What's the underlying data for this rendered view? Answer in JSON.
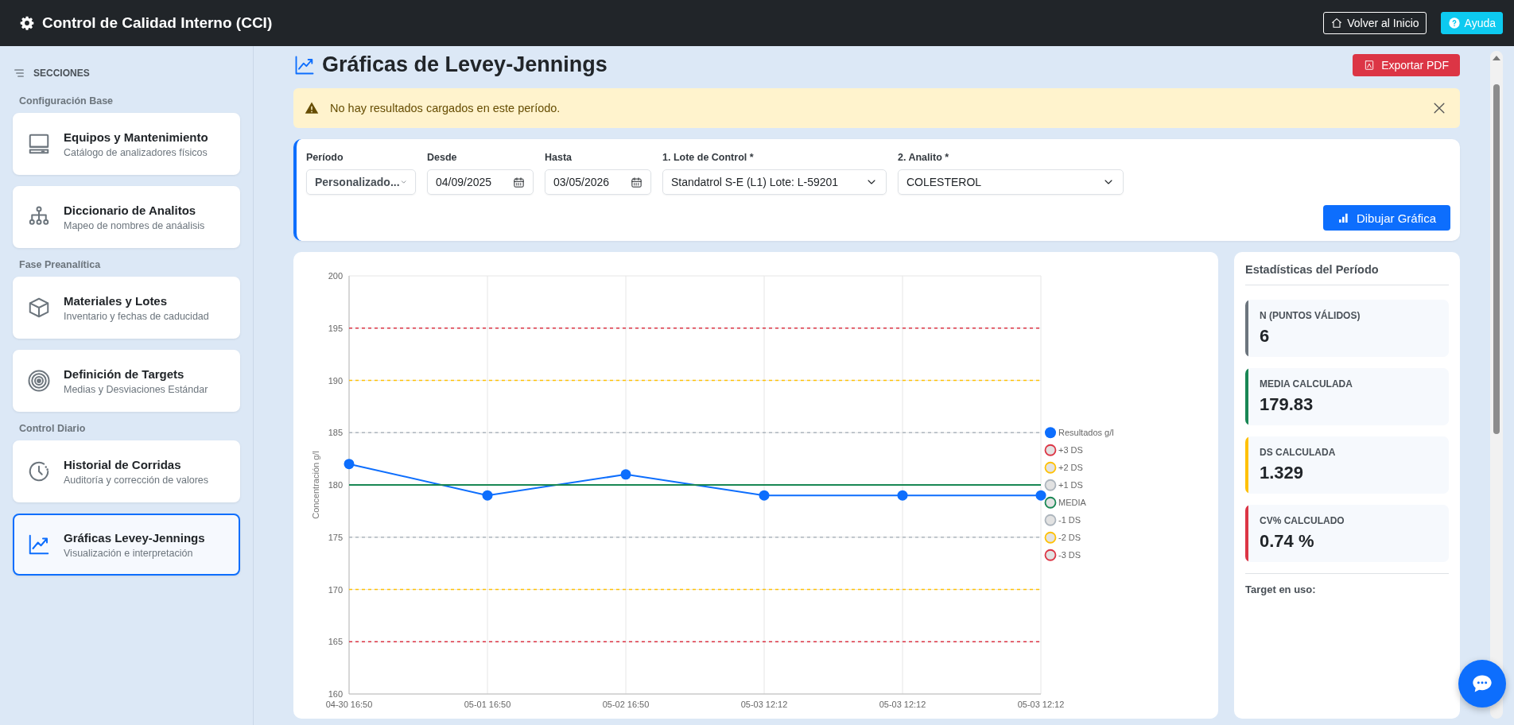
{
  "header": {
    "title": "Control de Calidad Interno (CCI)",
    "buttons": [
      {
        "kind": "home",
        "label": "Volver al Inicio"
      },
      {
        "kind": "help",
        "label": "Ayuda"
      }
    ]
  },
  "sidebar": {
    "heading": "SECCIONES",
    "groups": [
      {
        "title": "Configuración Base",
        "items": [
          {
            "title": "Equipos y Mantenimiento",
            "subtitle": "Catálogo de analizadores físicos",
            "selected": false
          },
          {
            "title": "Diccionario de Analitos",
            "subtitle": "Mapeo de nombres de anáalisis",
            "selected": false
          }
        ]
      },
      {
        "title": "Fase Preanalítica",
        "items": [
          {
            "title": "Materiales y Lotes",
            "subtitle": "Inventario y fechas de caducidad",
            "selected": false
          },
          {
            "title": "Definición de Targets",
            "subtitle": "Medias y Desviaciones Estándar",
            "selected": false
          }
        ]
      },
      {
        "title": "Control Diario",
        "items": [
          {
            "title": "Historial de Corridas",
            "subtitle": "Auditoría y corrección de valores",
            "selected": false
          },
          {
            "title": "Gráficas Levey-Jennings",
            "subtitle": "Visualización e interpretación",
            "selected": true
          }
        ]
      }
    ]
  },
  "page": {
    "title": "Gráficas de Levey-Jennings",
    "export_button": "Exportar PDF"
  },
  "alert": {
    "message": "No hay resultados cargados en este período."
  },
  "filters": {
    "fields": [
      {
        "kind": "select",
        "label": "Período",
        "value": "Personalizado..."
      },
      {
        "kind": "date",
        "label": "Desde",
        "value": "04/09/2025"
      },
      {
        "kind": "date",
        "label": "Hasta",
        "value": "03/05/2026"
      },
      {
        "kind": "select",
        "label": "1. Lote de Control *",
        "value": "Standatrol S-E (L1) Lote: L-59201"
      },
      {
        "kind": "select",
        "label": "2. Analito *",
        "value": "COLESTEROL"
      }
    ],
    "button": "Dibujar Gráfica"
  },
  "chart": {
    "chart_data": {
      "type": "line",
      "grid": true,
      "legend": true,
      "ylabel": "Concentración g/l",
      "categories": [
        "04-30 16:50",
        "05-01 16:50",
        "05-02 16:50",
        "05-03 12:12",
        "05-03 12:12",
        "05-03 12:12"
      ],
      "ylim": [
        160,
        200
      ],
      "yticks": [
        160,
        165,
        170,
        175,
        180,
        185,
        190,
        195,
        200
      ],
      "series": [
        {
          "name": "Resultados g/l",
          "line_style": "solid",
          "marker": "circle",
          "color": "#0d6efd",
          "values": [
            182,
            179,
            181,
            179,
            179,
            179
          ]
        },
        {
          "name": "+3 DS",
          "line_style": "dashed",
          "color": "#dc3545",
          "values": [
            195,
            195,
            195,
            195,
            195,
            195
          ]
        },
        {
          "name": "+2 DS",
          "line_style": "dashed",
          "color": "#ffc107",
          "values": [
            190,
            190,
            190,
            190,
            190,
            190
          ]
        },
        {
          "name": "+1 DS",
          "line_style": "dashed",
          "color": "#adb5bd",
          "values": [
            185,
            185,
            185,
            185,
            185,
            185
          ]
        },
        {
          "name": "MEDIA",
          "line_style": "solid",
          "color": "#198754",
          "values": [
            180,
            180,
            180,
            180,
            180,
            180
          ]
        },
        {
          "name": "-1 DS",
          "line_style": "dashed",
          "color": "#adb5bd",
          "values": [
            175,
            175,
            175,
            175,
            175,
            175
          ]
        },
        {
          "name": "-2 DS",
          "line_style": "dashed",
          "color": "#ffc107",
          "values": [
            170,
            170,
            170,
            170,
            170,
            170
          ]
        },
        {
          "name": "-3 DS",
          "line_style": "dashed",
          "color": "#dc3545",
          "values": [
            165,
            165,
            165,
            165,
            165,
            165
          ]
        }
      ]
    }
  },
  "stats": {
    "title": "Estadísticas del Período",
    "cards": [
      {
        "label": "N (PUNTOS VÁLIDOS)",
        "value": "6",
        "color": "#6c757d"
      },
      {
        "label": "MEDIA CALCULADA",
        "value": "179.83",
        "color": "#198754"
      },
      {
        "label": "DS CALCULADA",
        "value": "1.329",
        "color": "#ffc107"
      },
      {
        "label": "CV% CALCULADO",
        "value": "0.74 %",
        "color": "#dc3545"
      }
    ],
    "footer": "Target en uso:"
  }
}
